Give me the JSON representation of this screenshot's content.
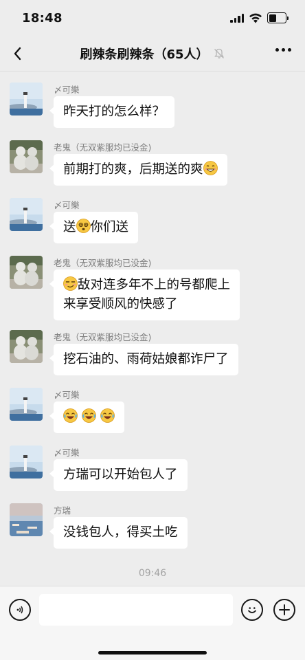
{
  "status_bar": {
    "time": "18:48",
    "icons": [
      "signal-icon",
      "wifi-icon",
      "battery-icon"
    ],
    "battery_level": 0.45
  },
  "nav": {
    "back_icon": "chevron-left-icon",
    "title": "刷辣条刷辣条（65人）",
    "mute_icon": "bell-off-icon",
    "more_icon": "more-icon"
  },
  "messages": [
    {
      "sender": "〆可樂",
      "text": "昨天打的怎么样？"
    },
    {
      "sender": "老鬼（无双紫服均已没金)",
      "text": "前期打的爽，后期送的爽",
      "emoji_after": "grin-emoji"
    },
    {
      "sender": "〆可樂",
      "text_before": "送",
      "emoji": "dizzy-emoji",
      "text": "你们送"
    },
    {
      "sender": "老鬼（无双紫服均已没金)",
      "emoji_before": "smirk-emoji",
      "line1": "敌对连多年不上的号都爬上",
      "line2": "来享受顺风的快感了"
    },
    {
      "sender": "老鬼（无双紫服均已没金)",
      "text": "挖石油的、雨荷姑娘都诈尸了"
    },
    {
      "sender": "〆可樂",
      "emojis": [
        "laugh-cry-emoji",
        "laugh-cry-emoji",
        "laugh-cry-emoji"
      ]
    },
    {
      "sender": "〆可樂",
      "text": "方瑞可以开始包人了"
    },
    {
      "sender": "方瑞",
      "text": "没钱包人，得买土吃"
    }
  ],
  "timestamp": "09:46",
  "input_bar": {
    "voice_icon": "voice-icon",
    "input_value": "",
    "emoji_icon": "smile-icon",
    "plus_icon": "plus-icon"
  },
  "colors": {
    "background": "#ededed",
    "bubble": "#ffffff",
    "sender_text": "#7d7d7d",
    "timestamp_text": "#a3a3a3"
  }
}
